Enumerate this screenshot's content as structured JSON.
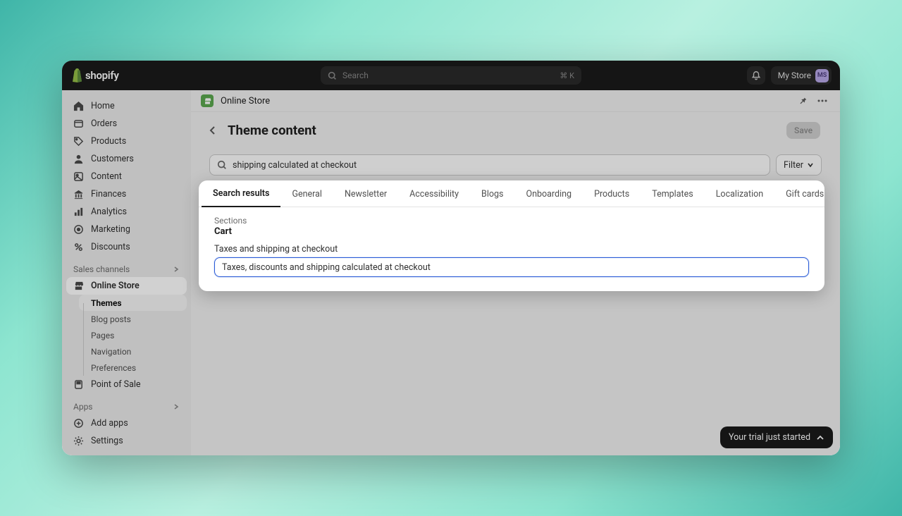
{
  "header": {
    "brand": "shopify",
    "search_placeholder": "Search",
    "search_shortcut": "⌘ K",
    "store_name": "My Store",
    "avatar_initials": "MS"
  },
  "sidebar": {
    "items": [
      {
        "label": "Home"
      },
      {
        "label": "Orders"
      },
      {
        "label": "Products"
      },
      {
        "label": "Customers"
      },
      {
        "label": "Content"
      },
      {
        "label": "Finances"
      },
      {
        "label": "Analytics"
      },
      {
        "label": "Marketing"
      },
      {
        "label": "Discounts"
      }
    ],
    "sales_channels_label": "Sales channels",
    "online_store": {
      "label": "Online Store"
    },
    "sub_items": [
      {
        "label": "Themes"
      },
      {
        "label": "Blog posts"
      },
      {
        "label": "Pages"
      },
      {
        "label": "Navigation"
      },
      {
        "label": "Preferences"
      }
    ],
    "point_of_sale": {
      "label": "Point of Sale"
    },
    "apps_label": "Apps",
    "add_apps": {
      "label": "Add apps"
    },
    "settings": {
      "label": "Settings"
    }
  },
  "main": {
    "breadcrumb": "Online Store",
    "page_title": "Theme content",
    "save_label": "Save",
    "search_value": "shipping calculated at checkout",
    "filter_label": "Filter"
  },
  "panel": {
    "tabs": [
      "Search results",
      "General",
      "Newsletter",
      "Accessibility",
      "Blogs",
      "Onboarding",
      "Products",
      "Templates",
      "Localization",
      "Gift cards"
    ],
    "section_label": "Sections",
    "section_title": "Cart",
    "field_label": "Taxes and shipping at checkout",
    "field_value": "Taxes, discounts and shipping calculated at checkout"
  },
  "trial_message": "Your trial just started"
}
